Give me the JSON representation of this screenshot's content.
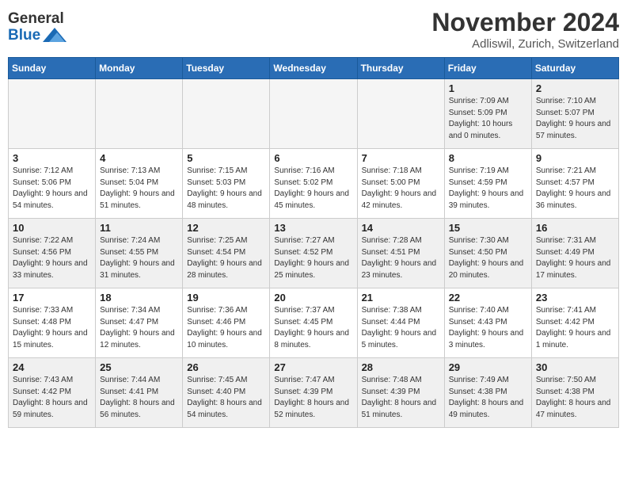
{
  "logo": {
    "text_general": "General",
    "text_blue": "Blue"
  },
  "header": {
    "month": "November 2024",
    "location": "Adliswil, Zurich, Switzerland"
  },
  "weekdays": [
    "Sunday",
    "Monday",
    "Tuesday",
    "Wednesday",
    "Thursday",
    "Friday",
    "Saturday"
  ],
  "weeks": [
    [
      {
        "day": "",
        "info": "",
        "empty": true
      },
      {
        "day": "",
        "info": "",
        "empty": true
      },
      {
        "day": "",
        "info": "",
        "empty": true
      },
      {
        "day": "",
        "info": "",
        "empty": true
      },
      {
        "day": "",
        "info": "",
        "empty": true
      },
      {
        "day": "1",
        "info": "Sunrise: 7:09 AM\nSunset: 5:09 PM\nDaylight: 10 hours\nand 0 minutes.",
        "empty": false
      },
      {
        "day": "2",
        "info": "Sunrise: 7:10 AM\nSunset: 5:07 PM\nDaylight: 9 hours\nand 57 minutes.",
        "empty": false
      }
    ],
    [
      {
        "day": "3",
        "info": "Sunrise: 7:12 AM\nSunset: 5:06 PM\nDaylight: 9 hours\nand 54 minutes.",
        "empty": false
      },
      {
        "day": "4",
        "info": "Sunrise: 7:13 AM\nSunset: 5:04 PM\nDaylight: 9 hours\nand 51 minutes.",
        "empty": false
      },
      {
        "day": "5",
        "info": "Sunrise: 7:15 AM\nSunset: 5:03 PM\nDaylight: 9 hours\nand 48 minutes.",
        "empty": false
      },
      {
        "day": "6",
        "info": "Sunrise: 7:16 AM\nSunset: 5:02 PM\nDaylight: 9 hours\nand 45 minutes.",
        "empty": false
      },
      {
        "day": "7",
        "info": "Sunrise: 7:18 AM\nSunset: 5:00 PM\nDaylight: 9 hours\nand 42 minutes.",
        "empty": false
      },
      {
        "day": "8",
        "info": "Sunrise: 7:19 AM\nSunset: 4:59 PM\nDaylight: 9 hours\nand 39 minutes.",
        "empty": false
      },
      {
        "day": "9",
        "info": "Sunrise: 7:21 AM\nSunset: 4:57 PM\nDaylight: 9 hours\nand 36 minutes.",
        "empty": false
      }
    ],
    [
      {
        "day": "10",
        "info": "Sunrise: 7:22 AM\nSunset: 4:56 PM\nDaylight: 9 hours\nand 33 minutes.",
        "empty": false
      },
      {
        "day": "11",
        "info": "Sunrise: 7:24 AM\nSunset: 4:55 PM\nDaylight: 9 hours\nand 31 minutes.",
        "empty": false
      },
      {
        "day": "12",
        "info": "Sunrise: 7:25 AM\nSunset: 4:54 PM\nDaylight: 9 hours\nand 28 minutes.",
        "empty": false
      },
      {
        "day": "13",
        "info": "Sunrise: 7:27 AM\nSunset: 4:52 PM\nDaylight: 9 hours\nand 25 minutes.",
        "empty": false
      },
      {
        "day": "14",
        "info": "Sunrise: 7:28 AM\nSunset: 4:51 PM\nDaylight: 9 hours\nand 23 minutes.",
        "empty": false
      },
      {
        "day": "15",
        "info": "Sunrise: 7:30 AM\nSunset: 4:50 PM\nDaylight: 9 hours\nand 20 minutes.",
        "empty": false
      },
      {
        "day": "16",
        "info": "Sunrise: 7:31 AM\nSunset: 4:49 PM\nDaylight: 9 hours\nand 17 minutes.",
        "empty": false
      }
    ],
    [
      {
        "day": "17",
        "info": "Sunrise: 7:33 AM\nSunset: 4:48 PM\nDaylight: 9 hours\nand 15 minutes.",
        "empty": false
      },
      {
        "day": "18",
        "info": "Sunrise: 7:34 AM\nSunset: 4:47 PM\nDaylight: 9 hours\nand 12 minutes.",
        "empty": false
      },
      {
        "day": "19",
        "info": "Sunrise: 7:36 AM\nSunset: 4:46 PM\nDaylight: 9 hours\nand 10 minutes.",
        "empty": false
      },
      {
        "day": "20",
        "info": "Sunrise: 7:37 AM\nSunset: 4:45 PM\nDaylight: 9 hours\nand 8 minutes.",
        "empty": false
      },
      {
        "day": "21",
        "info": "Sunrise: 7:38 AM\nSunset: 4:44 PM\nDaylight: 9 hours\nand 5 minutes.",
        "empty": false
      },
      {
        "day": "22",
        "info": "Sunrise: 7:40 AM\nSunset: 4:43 PM\nDaylight: 9 hours\nand 3 minutes.",
        "empty": false
      },
      {
        "day": "23",
        "info": "Sunrise: 7:41 AM\nSunset: 4:42 PM\nDaylight: 9 hours\nand 1 minute.",
        "empty": false
      }
    ],
    [
      {
        "day": "24",
        "info": "Sunrise: 7:43 AM\nSunset: 4:42 PM\nDaylight: 8 hours\nand 59 minutes.",
        "empty": false
      },
      {
        "day": "25",
        "info": "Sunrise: 7:44 AM\nSunset: 4:41 PM\nDaylight: 8 hours\nand 56 minutes.",
        "empty": false
      },
      {
        "day": "26",
        "info": "Sunrise: 7:45 AM\nSunset: 4:40 PM\nDaylight: 8 hours\nand 54 minutes.",
        "empty": false
      },
      {
        "day": "27",
        "info": "Sunrise: 7:47 AM\nSunset: 4:39 PM\nDaylight: 8 hours\nand 52 minutes.",
        "empty": false
      },
      {
        "day": "28",
        "info": "Sunrise: 7:48 AM\nSunset: 4:39 PM\nDaylight: 8 hours\nand 51 minutes.",
        "empty": false
      },
      {
        "day": "29",
        "info": "Sunrise: 7:49 AM\nSunset: 4:38 PM\nDaylight: 8 hours\nand 49 minutes.",
        "empty": false
      },
      {
        "day": "30",
        "info": "Sunrise: 7:50 AM\nSunset: 4:38 PM\nDaylight: 8 hours\nand 47 minutes.",
        "empty": false
      }
    ]
  ]
}
